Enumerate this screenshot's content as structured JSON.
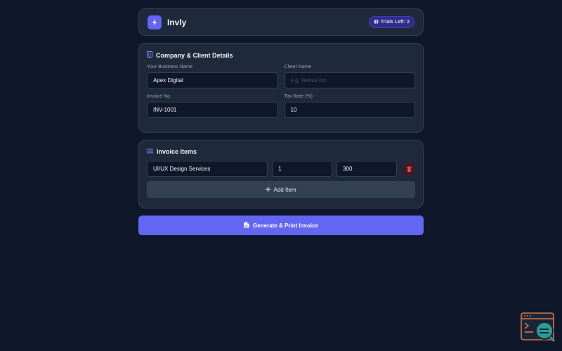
{
  "header": {
    "app_name": "Invly",
    "trials_label": "Trials Left: 2"
  },
  "details": {
    "title": "Company & Client Details",
    "business_name": {
      "label": "Your Business Name",
      "value": "Apex Digital",
      "placeholder": ""
    },
    "client_name": {
      "label": "Client Name",
      "value": "",
      "placeholder": "e.g. Nexus Inc"
    },
    "invoice_no": {
      "label": "Invoice No",
      "value": "INV-1001",
      "placeholder": ""
    },
    "tax_rate": {
      "label": "Tax Rate (%)",
      "value": "10",
      "placeholder": ""
    }
  },
  "items": {
    "title": "Invoice Items",
    "rows": [
      {
        "description": "UI/UX Design Services",
        "quantity": "1",
        "price": "300"
      }
    ],
    "add_label": "Add Item"
  },
  "actions": {
    "generate_label": "Generate & Print Invoice"
  },
  "icons": {
    "logo": "lightning-icon",
    "trials": "gift-icon",
    "details": "building-icon",
    "items": "list-icon",
    "delete": "trash-icon",
    "add": "plus-icon",
    "generate": "file-icon"
  },
  "colors": {
    "background": "#0f172a",
    "card": "#1e293b",
    "accent": "#6366f1",
    "danger": "#ef4444"
  }
}
